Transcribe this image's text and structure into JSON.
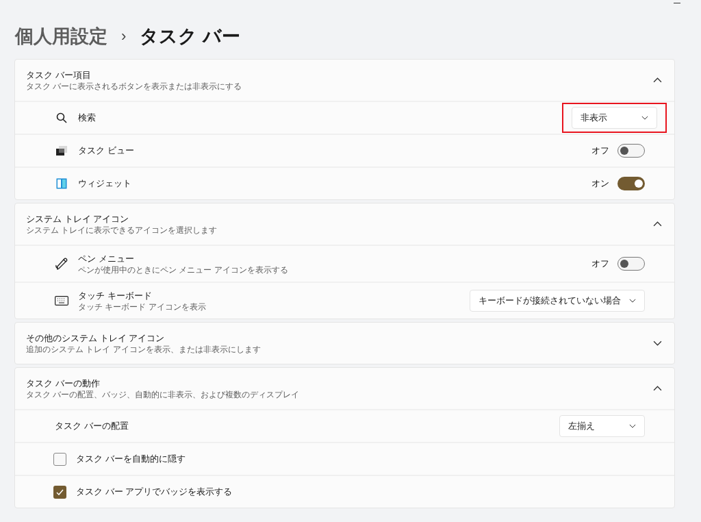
{
  "breadcrumb": {
    "parent": "個人用設定",
    "separator": "›",
    "current": "タスク バー"
  },
  "sections": [
    {
      "title": "タスク バー項目",
      "subtitle": "タスク バーに表示されるボタンを表示または非表示にする",
      "expanded": true,
      "rows": [
        {
          "kind": "dropdown",
          "label": "検索",
          "value": "非表示",
          "highlighted": true
        },
        {
          "kind": "toggle",
          "label": "タスク ビュー",
          "state_text": "オフ",
          "on": false
        },
        {
          "kind": "toggle",
          "label": "ウィジェット",
          "state_text": "オン",
          "on": true
        }
      ]
    },
    {
      "title": "システム トレイ アイコン",
      "subtitle": "システム トレイに表示できるアイコンを選択します",
      "expanded": true,
      "rows": [
        {
          "kind": "toggle",
          "label": "ペン メニュー",
          "description": "ペンが使用中のときにペン メニュー アイコンを表示する",
          "state_text": "オフ",
          "on": false
        },
        {
          "kind": "dropdown",
          "label": "タッチ キーボード",
          "description": "タッチ キーボード アイコンを表示",
          "value": "キーボードが接続されていない場合",
          "highlighted": false
        }
      ]
    },
    {
      "title": "その他のシステム トレイ アイコン",
      "subtitle": "追加のシステム トレイ アイコンを表示、または非表示にします",
      "expanded": false
    },
    {
      "title": "タスク バーの動作",
      "subtitle": "タスク バーの配置、バッジ、自動的に非表示、および複数のディスプレイ",
      "expanded": true,
      "rows": [
        {
          "kind": "dropdown",
          "label": "タスク バーの配置",
          "value": "左揃え",
          "highlighted": false
        },
        {
          "kind": "checkbox",
          "label": "タスク バーを自動的に隠す",
          "checked": false
        },
        {
          "kind": "checkbox",
          "label": "タスク バー アプリでバッジを表示する",
          "checked": true
        }
      ]
    }
  ]
}
